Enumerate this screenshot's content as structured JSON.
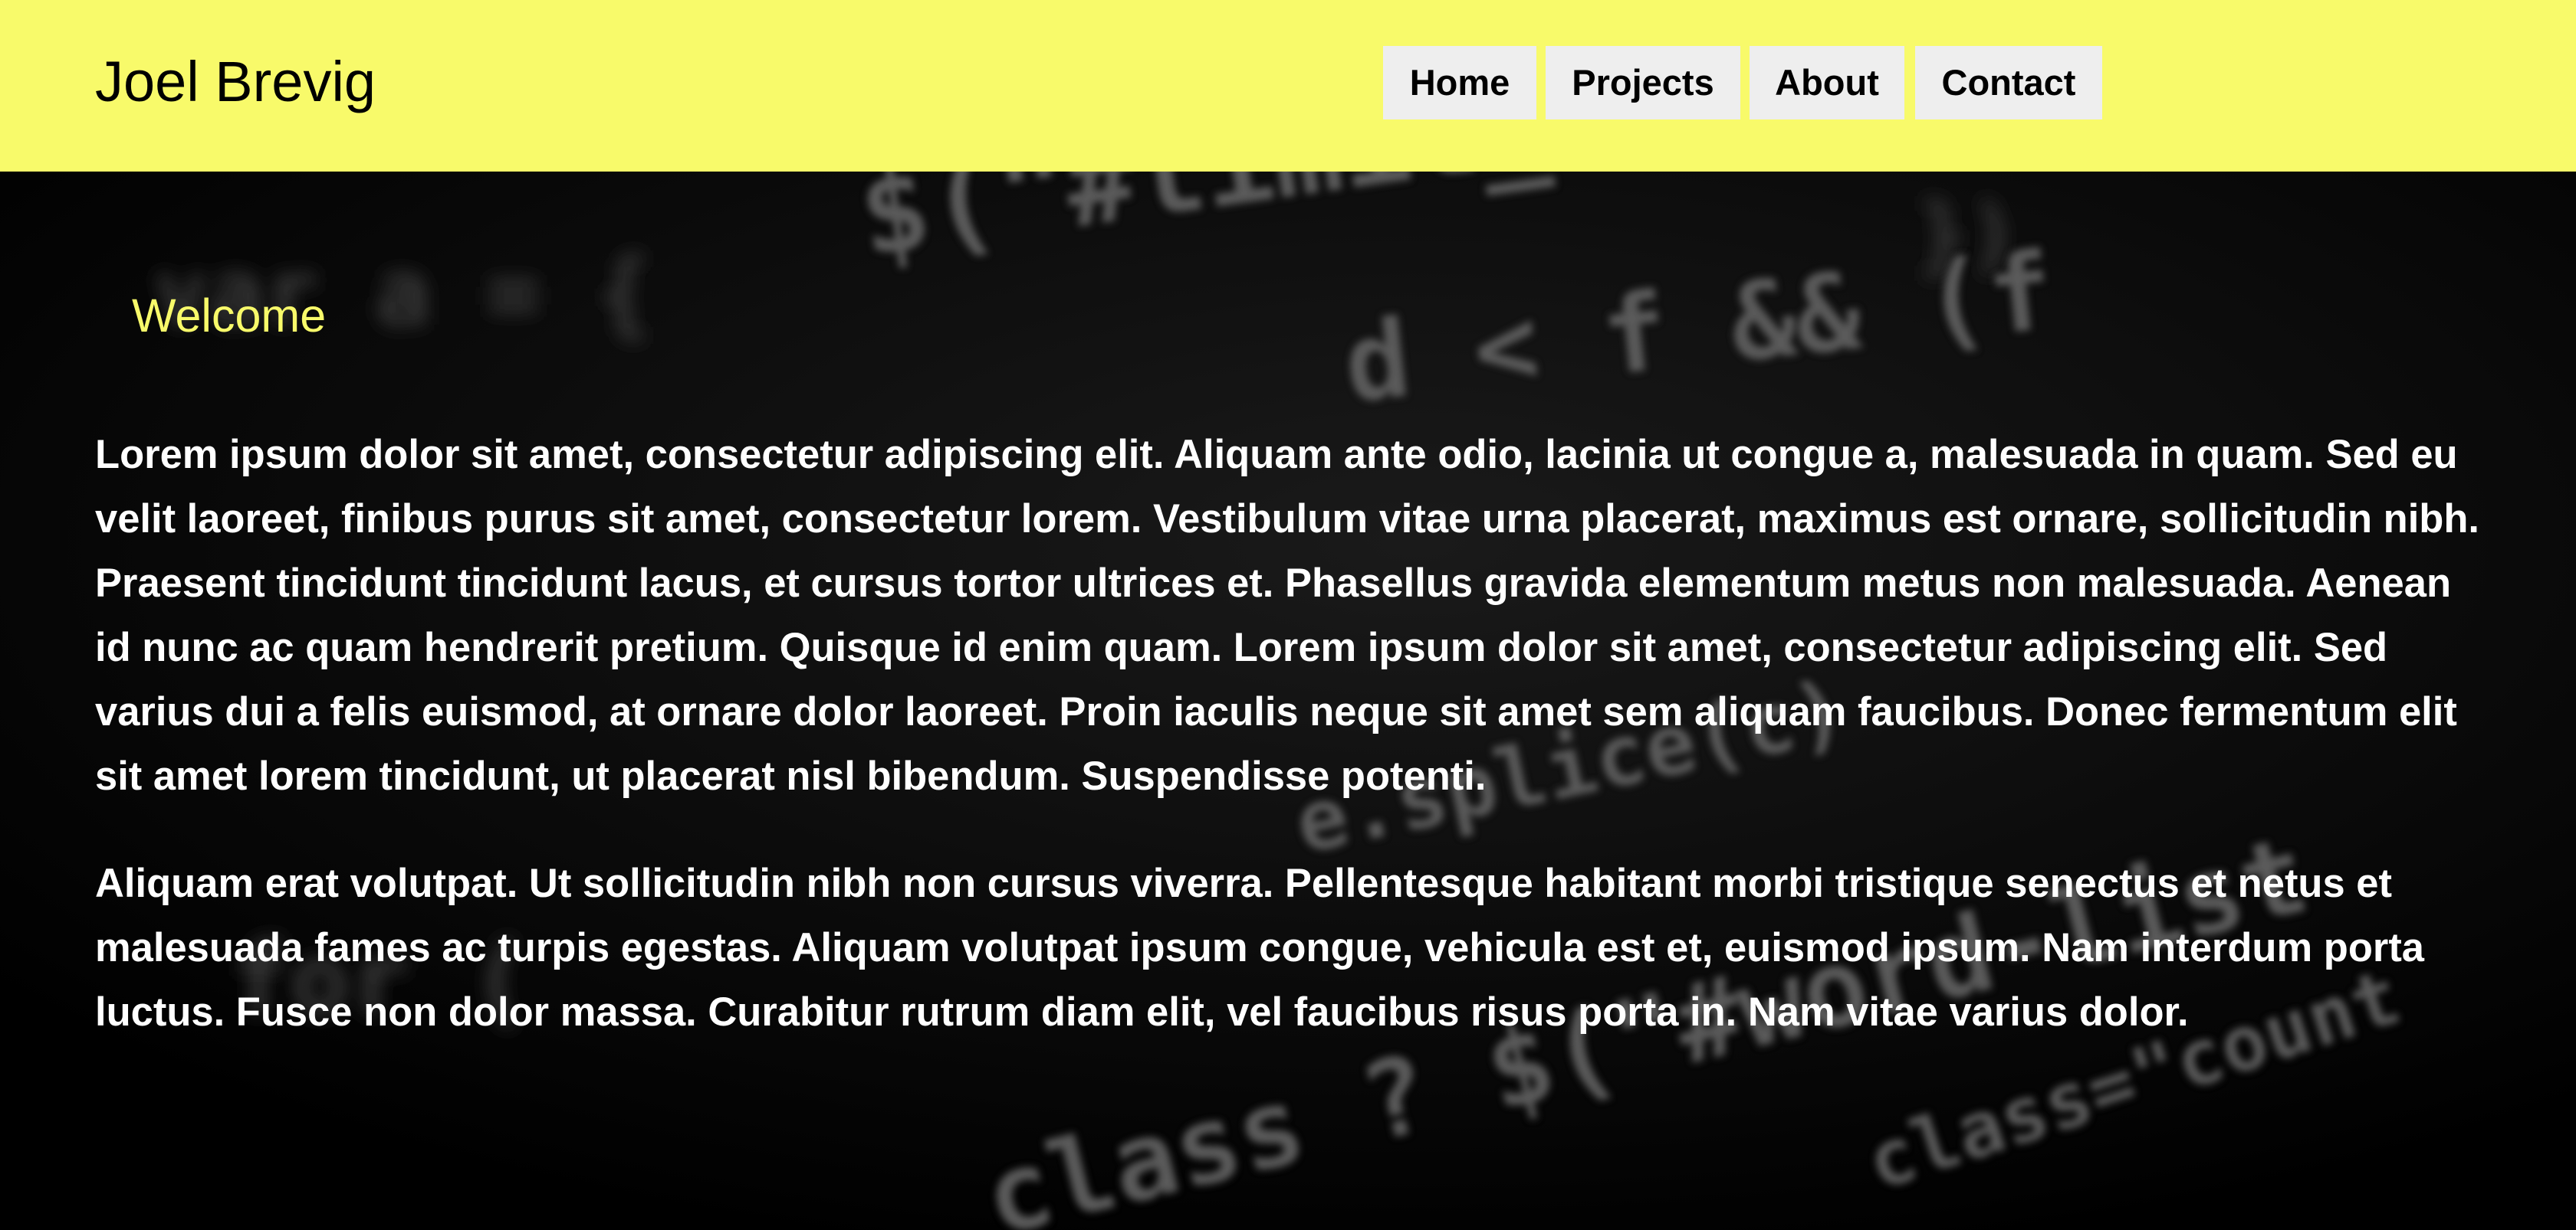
{
  "header": {
    "brand": "Joel Brevig",
    "background": "#f8fa6a",
    "nav": [
      {
        "label": "Home"
      },
      {
        "label": "Projects"
      },
      {
        "label": "About"
      },
      {
        "label": "Contact"
      }
    ]
  },
  "main": {
    "heading": "Welcome",
    "heading_color": "#f8fa6a",
    "paragraphs": [
      "Lorem ipsum dolor sit amet, consectetur adipiscing elit. Aliquam ante odio, lacinia ut congue a, malesuada in quam. Sed eu velit laoreet, finibus purus sit amet, consectetur lorem. Vestibulum vitae urna placerat, maximus est ornare, sollicitudin nibh. Praesent tincidunt tincidunt lacus, et cursus tortor ultrices et. Phasellus gravida elementum metus non malesuada. Aenean id nunc ac quam hendrerit pretium. Quisque id enim quam. Lorem ipsum dolor sit amet, consectetur adipiscing elit. Sed varius dui a felis euismod, at ornare dolor laoreet. Proin iaculis neque sit amet sem aliquam faucibus. Donec fermentum elit sit amet lorem tincidunt, ut placerat nisl bibendum. Suspendisse potenti.",
      "Aliquam erat volutpat. Ut sollicitudin nibh non cursus viverra. Pellentesque habitant morbi tristique senectus et netus et malesuada fames ac turpis egestas. Aliquam volutpat ipsum congue, vehicula est et, euismod ipsum. Nam interdum porta luctus. Fusce non dolor massa. Curabitur rutrum diam elit, vel faucibus risus porta in. Nam vitae varius dolor."
    ]
  },
  "background_image": {
    "description_icon": "code-background-image",
    "code_fragments": [
      "$(\"#limit_val\").val();",
      "d < f && (f",
      "e.splice(c)",
      "class ? $(\"#word-list",
      "class=\"count"
    ]
  }
}
